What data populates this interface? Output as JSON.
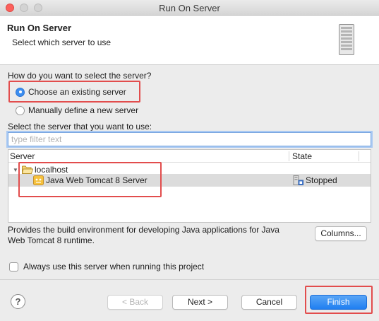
{
  "window": {
    "title": "Run On Server"
  },
  "header": {
    "title": "Run On Server",
    "description": "Select which server to use"
  },
  "selection": {
    "question": "How do you want to select the server?",
    "options": [
      {
        "label": "Choose an existing server",
        "selected": true
      },
      {
        "label": "Manually define a new server",
        "selected": false
      }
    ],
    "list_label": "Select the server that you want to use:",
    "filter": {
      "value": "",
      "placeholder": "type filter text"
    }
  },
  "server_table": {
    "columns": [
      "Server",
      "State"
    ],
    "host": {
      "name": "localhost",
      "expanded": true
    },
    "servers": [
      {
        "name": "Java Web Tomcat 8 Server",
        "state": "Stopped",
        "selected": true
      }
    ]
  },
  "description": "Provides the build environment for developing Java applications for Java Web Tomcat 8 runtime.",
  "buttons": {
    "columns": "Columns...",
    "back": "< Back",
    "next": "Next >",
    "cancel": "Cancel",
    "finish": "Finish"
  },
  "always_use": {
    "label": "Always use this server when running this project",
    "checked": false
  },
  "colors": {
    "highlight": "#e24d4d",
    "accent": "#1f7ff1",
    "close": "#fc605c"
  },
  "icons": [
    "server-icon",
    "folder-icon",
    "tomcat-icon",
    "server-state-icon",
    "help-icon",
    "disclosure-triangle-icon"
  ]
}
